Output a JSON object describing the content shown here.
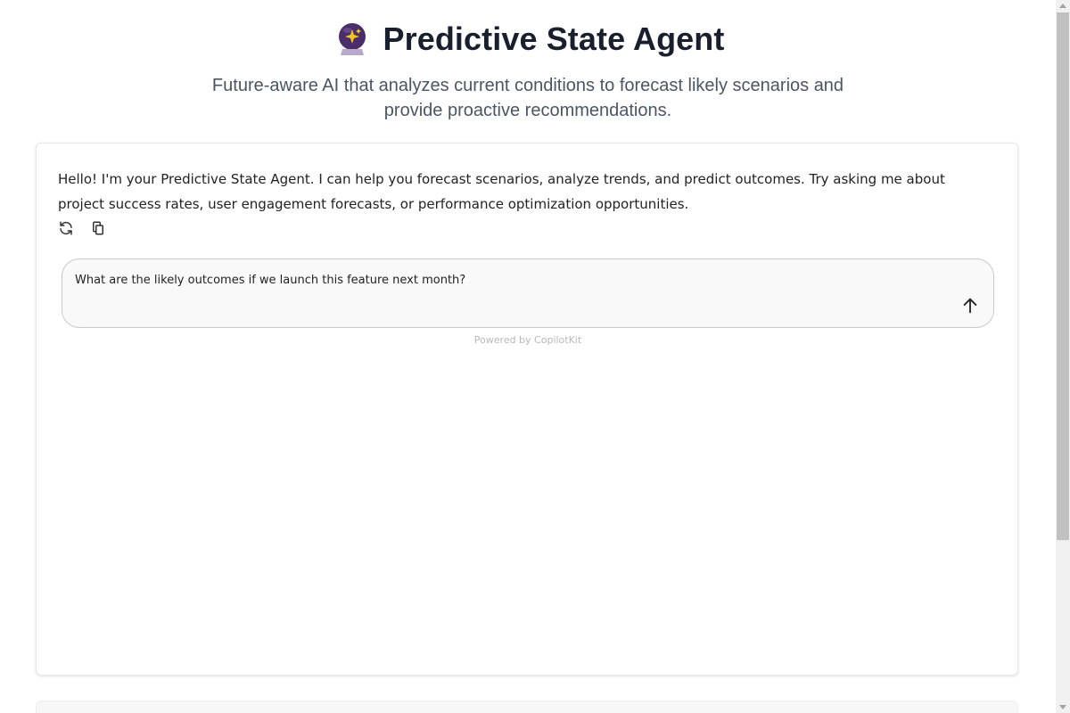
{
  "header": {
    "icon": "crystal-ball-icon",
    "title": "Predictive State Agent",
    "subtitle": "Future-aware AI that analyzes current conditions to forecast likely scenarios and provide proactive recommendations."
  },
  "chat": {
    "messages": [
      {
        "role": "assistant",
        "text": "Hello! I'm your Predictive State Agent. I can help you forecast scenarios, analyze trends, and predict outcomes. Try asking me about project success rates, user engagement forecasts, or performance optimization opportunities."
      }
    ],
    "message_controls": [
      "regenerate-icon",
      "copy-icon"
    ],
    "input": {
      "value": "What are the likely outcomes if we launch this feature next month?",
      "placeholder": ""
    },
    "send_icon": "arrow-up-icon",
    "powered_by": "Powered by CopilotKit"
  },
  "colors": {
    "title": "#1a1f2e",
    "subtitle": "#4b5563",
    "orb": "#4a2d6b",
    "sparkle": "#f5c518",
    "input_bg": "#f9f9f9"
  }
}
